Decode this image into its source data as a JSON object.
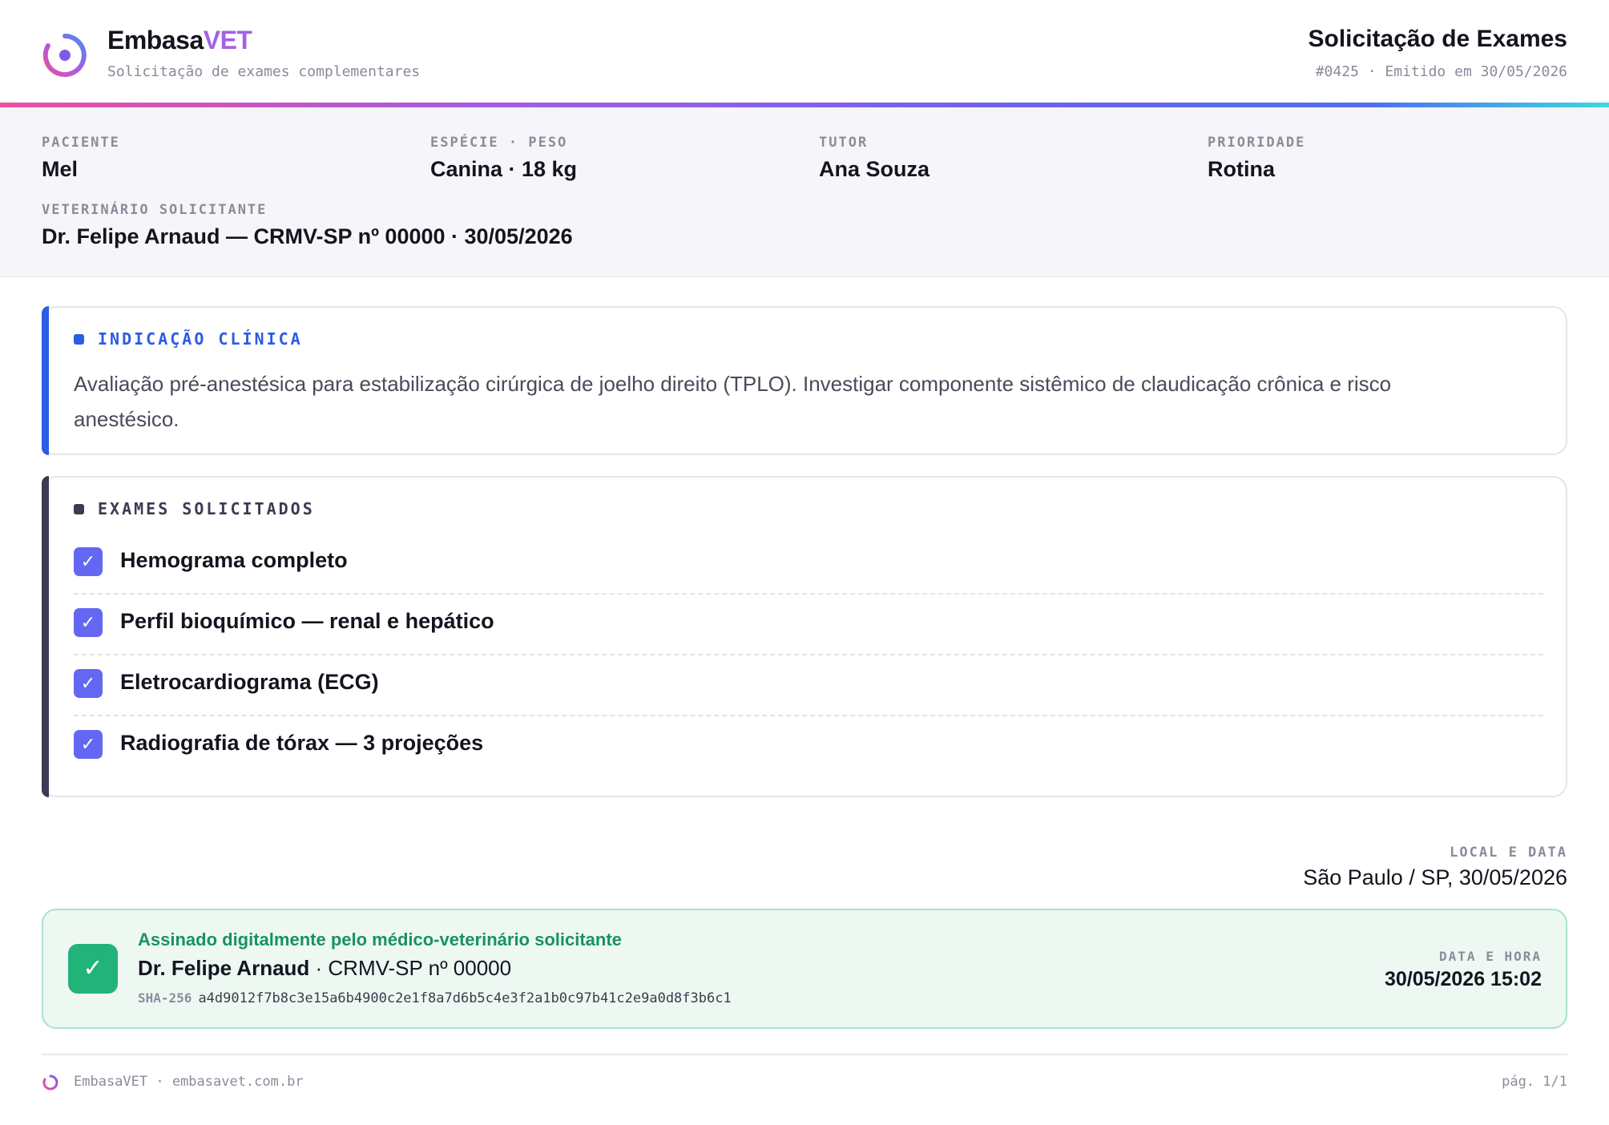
{
  "header": {
    "brand_main": "Embasa",
    "brand_accent": "VET",
    "brand_subtitle": "Solicitação de exames complementares",
    "doc_title": "Solicitação de Exames",
    "doc_meta": "#0425 · Emitido em 30/05/2026"
  },
  "patient": {
    "patient_label": "PACIENTE",
    "patient_value": "Mel",
    "species_label": "ESPÉCIE · PESO",
    "species_value": "Canina · 18 kg",
    "tutor_label": "TUTOR",
    "tutor_value": "Ana Souza",
    "priority_label": "PRIORIDADE",
    "priority_value": "Rotina",
    "vet_label": "VETERINÁRIO SOLICITANTE",
    "vet_value": "Dr. Felipe Arnaud — CRMV-SP nº 00000 · 30/05/2026"
  },
  "indication": {
    "title": "INDICAÇÃO CLÍNICA",
    "text": "Avaliação pré-anestésica para estabilização cirúrgica de joelho direito (TPLO). Investigar componente sistêmico de claudicação crônica e risco anestésico."
  },
  "exams": {
    "title": "EXAMES SOLICITADOS",
    "check_glyph": "✓",
    "items": [
      "Hemograma completo",
      "Perfil bioquímico — renal e hepático",
      "Eletrocardiograma (ECG)",
      "Radiografia de tórax — 3 projeções"
    ]
  },
  "location": {
    "label": "LOCAL E DATA",
    "value": "São Paulo / SP, 30/05/2026"
  },
  "signature": {
    "badge_glyph": "✓",
    "title": "Assinado digitalmente pelo médico-veterinário solicitante",
    "name": "Dr. Felipe Arnaud",
    "registration": " · CRMV-SP nº 00000",
    "hash_label": "SHA-256",
    "hash_value": "a4d9012f7b8c3e15a6b4900c2e1f8a7d6b5c4e3f2a1b0c97b41c2e9a0d8f3b6c1",
    "datetime_label": "DATA E HORA",
    "datetime_value": "30/05/2026 15:02"
  },
  "footer": {
    "left": "EmbasaVET · embasavet.com.br",
    "right": "pág. 1/1"
  },
  "colors": {
    "accent": "#a461e6",
    "indication_blue": "#2d5be3",
    "exam_dark": "#3c3b52",
    "check_purple": "#6467f2",
    "signature_green": "#22b37a"
  },
  "icons": {
    "logo": "ring-logo-icon",
    "check": "check-icon"
  }
}
